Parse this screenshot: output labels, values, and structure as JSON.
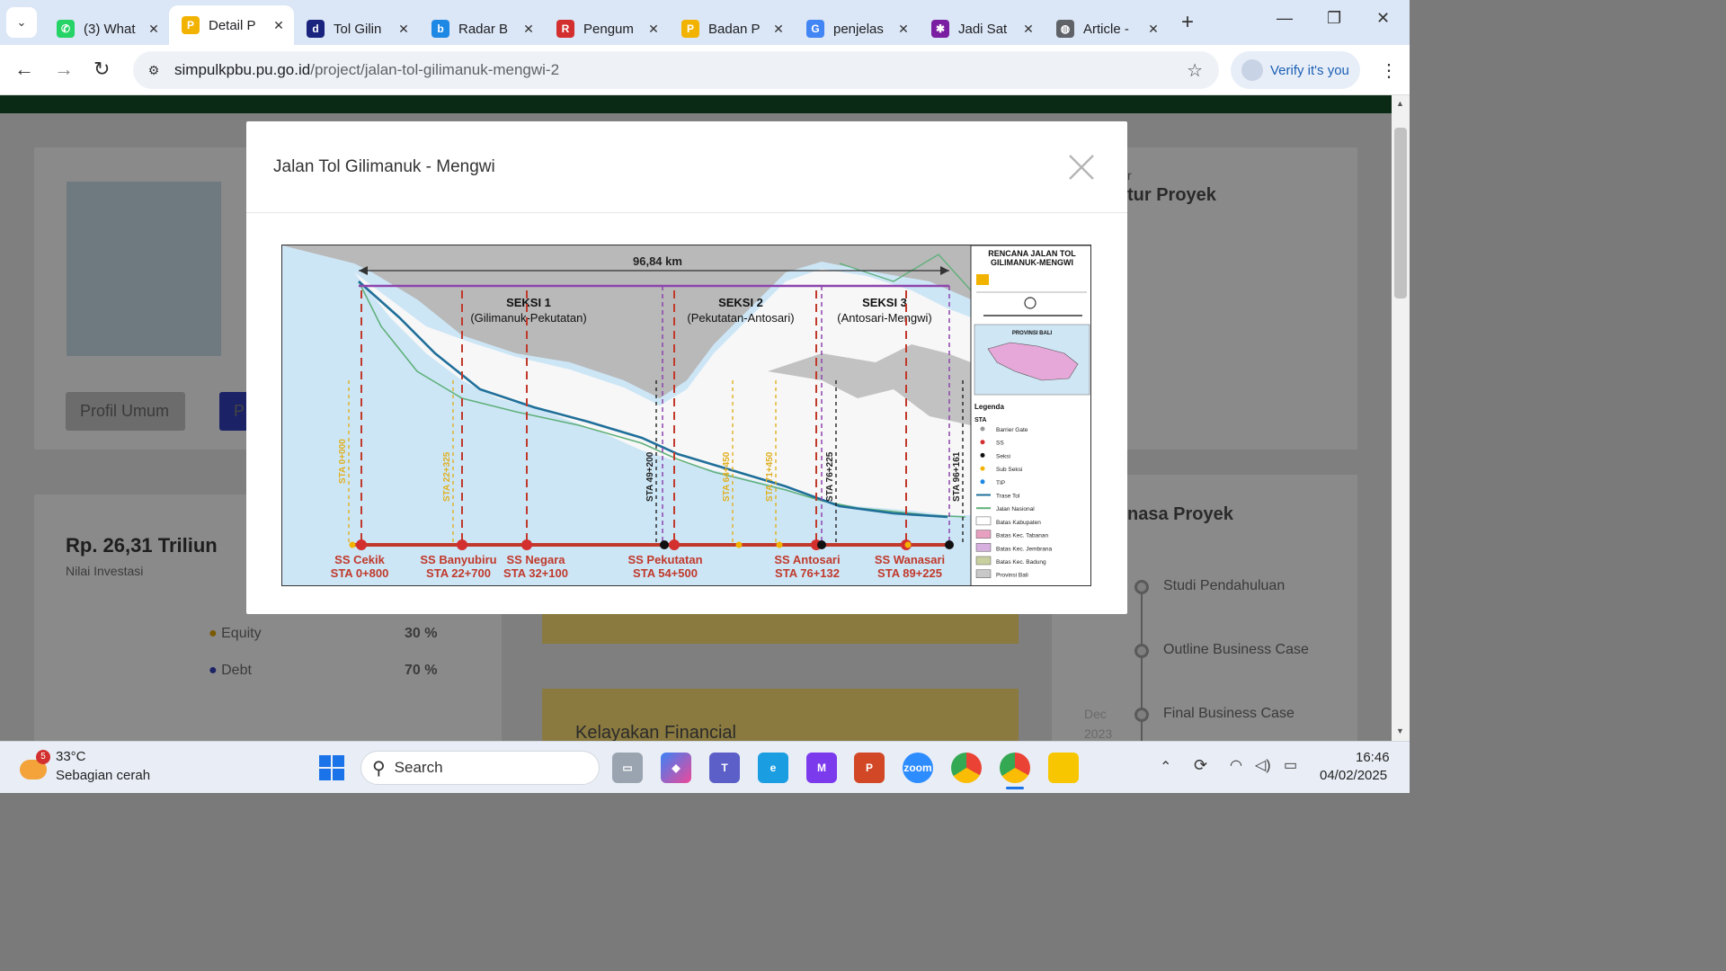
{
  "browser": {
    "tabs": [
      {
        "title": "(3) What",
        "favicon": "whatsapp-icon",
        "color": "#25d366",
        "glyph": "✆"
      },
      {
        "title": "Detail P",
        "favicon": "pupr-icon",
        "color": "#f2b200",
        "glyph": "P",
        "active": true
      },
      {
        "title": "Tol Gilin",
        "favicon": "detik-icon",
        "color": "#1a237e",
        "glyph": "d"
      },
      {
        "title": "Radar B",
        "favicon": "radar-icon",
        "color": "#1e88e5",
        "glyph": "b"
      },
      {
        "title": "Pengum",
        "favicon": "rs-icon",
        "color": "#d32f2f",
        "glyph": "R"
      },
      {
        "title": "Badan P",
        "favicon": "pupr-icon",
        "color": "#f2b200",
        "glyph": "P"
      },
      {
        "title": "penjelas",
        "favicon": "google-icon",
        "color": "#4285f4",
        "glyph": "G"
      },
      {
        "title": "Jadi Sat",
        "favicon": "cnbc-icon",
        "color": "#7b1fa2",
        "glyph": "✱"
      },
      {
        "title": "Article -",
        "favicon": "globe-icon",
        "color": "#5f6368",
        "glyph": "◍"
      }
    ],
    "url_domain": "simpulkpbu.pu.go.id",
    "url_path": "/project/jalan-tol-gilimanuk-mengwi-2",
    "verify_label": "Verify it's you"
  },
  "background_page": {
    "profil_umum": "Profil Umum",
    "tab_p": "P",
    "nilai_investasi": "Rp. 26,31 Triliun",
    "nilai_label": "Nilai Investasi",
    "equity_label": "Equity",
    "equity_value": "30 %",
    "debt_label": "Debt",
    "debt_value": "70 %",
    "struktur_title_part": "tur Proyek",
    "struktur_title_pre": "r",
    "masa_title": "nasa Proyek",
    "kelayakan": "Kelayakan Financial",
    "timeline": [
      "Studi Pendahuluan",
      "Outline Business Case",
      "Final Business Case"
    ],
    "timeline_date": "Dec",
    "timeline_year": "2023"
  },
  "modal": {
    "title": "Jalan Tol Gilimanuk - Mengwi",
    "map": {
      "distance": "96,84 km",
      "legend_title_1": "RENCANA JALAN TOL",
      "legend_title_2": "GILIMANUK-MENGWI",
      "province": "PROVINSI BALI",
      "legend_heading": "Legenda",
      "sta_heading": "STA",
      "legend_items": [
        "Barrier Gate",
        "SS",
        "Seksi",
        "Sub Seksi",
        "TIP",
        "Trase Tol",
        "Jalan Nasional",
        "Batas Kabupaten",
        "Batas Kec. Tabanan",
        "Batas Kec. Jembrana",
        "Batas Kec. Badung",
        "Provinsi Bali"
      ],
      "sections": [
        {
          "name": "SEKSI 1",
          "sub": "(Gilimanuk-Pekutatan)"
        },
        {
          "name": "SEKSI 2",
          "sub": "(Pekutatan-Antosari)"
        },
        {
          "name": "SEKSI 3",
          "sub": "(Antosari-Mengwi)"
        }
      ],
      "stations": [
        {
          "name": "SS Cekik",
          "sta": "STA 0+800"
        },
        {
          "name": "SS Banyubiru",
          "sta": "STA 22+700"
        },
        {
          "name": "SS Negara",
          "sta": "STA 32+100"
        },
        {
          "name": "SS Pekutatan",
          "sta": "STA 54+500"
        },
        {
          "name": "SS Antosari",
          "sta": "STA 76+132"
        },
        {
          "name": "SS Wanasari",
          "sta": "STA 89+225"
        }
      ],
      "vertical_labels": [
        "STA 0+000",
        "STA 22+325",
        "STA 49+200",
        "STA 64+450",
        "STA 71+450",
        "STA 76+225",
        "STA 96+161"
      ]
    }
  },
  "taskbar": {
    "weather_temp": "33°C",
    "weather_desc": "Sebagian cerah",
    "weather_badge": "5",
    "search": "Search",
    "time": "16:46",
    "date": "04/02/2025"
  }
}
